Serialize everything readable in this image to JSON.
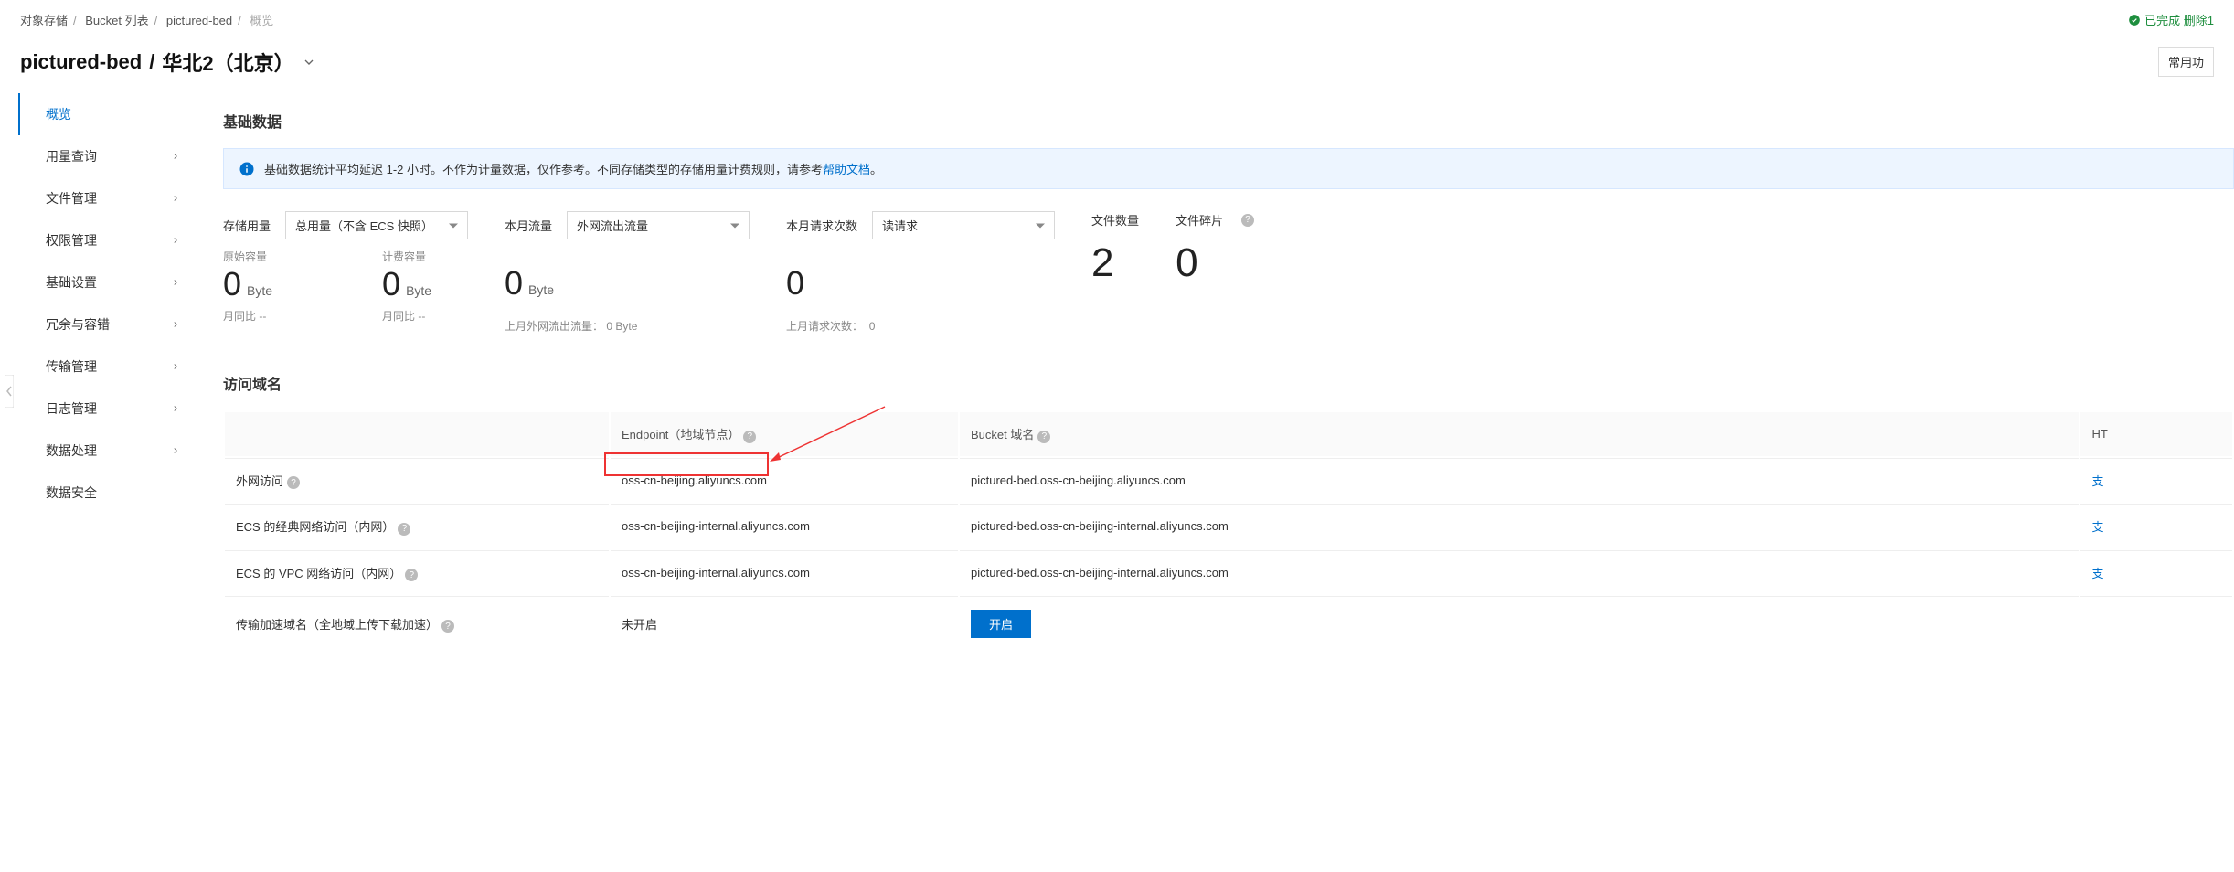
{
  "breadcrumb": {
    "root": "对象存储",
    "bucketList": "Bucket 列表",
    "bucket": "pictured-bed",
    "current": "概览"
  },
  "status": "已完成 删除1",
  "title": {
    "bucket": "pictured-bed",
    "region": "华北2（北京）"
  },
  "frequentBtn": "常用功",
  "sidebar": {
    "items": [
      {
        "label": "概览",
        "hasChev": false,
        "active": true
      },
      {
        "label": "用量查询",
        "hasChev": true
      },
      {
        "label": "文件管理",
        "hasChev": true
      },
      {
        "label": "权限管理",
        "hasChev": true
      },
      {
        "label": "基础设置",
        "hasChev": true
      },
      {
        "label": "冗余与容错",
        "hasChev": true
      },
      {
        "label": "传输管理",
        "hasChev": true
      },
      {
        "label": "日志管理",
        "hasChev": true
      },
      {
        "label": "数据处理",
        "hasChev": true
      },
      {
        "label": "数据安全",
        "hasChev": false
      }
    ]
  },
  "sections": {
    "basicData": "基础数据",
    "accessDomain": "访问域名"
  },
  "alert": {
    "text": "基础数据统计平均延迟 1-2 小时。不作为计量数据，仅作参考。不同存储类型的存储用量计费规则，请参考",
    "link": "帮助文档",
    "tail": "。"
  },
  "stats": {
    "storage": {
      "label": "存储用量",
      "selectValue": "总用量（不含 ECS 快照）",
      "raw": {
        "label": "原始容量",
        "value": "0",
        "unit": "Byte",
        "compare": "月同比  --"
      },
      "billed": {
        "label": "计费容量",
        "value": "0",
        "unit": "Byte",
        "compare": "月同比  --"
      }
    },
    "traffic": {
      "label": "本月流量",
      "selectValue": "外网流出流量",
      "value": "0",
      "unit": "Byte",
      "last": {
        "label": "上月外网流出流量：",
        "value": "0 Byte"
      }
    },
    "requests": {
      "label": "本月请求次数",
      "selectValue": "读请求",
      "value": "0",
      "last": {
        "label": "上月请求次数：",
        "value": "0"
      }
    },
    "files": {
      "label": "文件数量",
      "value": "2"
    },
    "fragments": {
      "label": "文件碎片",
      "value": "0"
    }
  },
  "domain": {
    "headers": {
      "type": "",
      "endpoint": "Endpoint（地域节点）",
      "bucket": "Bucket 域名",
      "right": "HT"
    },
    "rows": [
      {
        "type": "外网访问",
        "help": true,
        "endpoint": "oss-cn-beijing.aliyuncs.com",
        "bucket": "pictured-bed.oss-cn-beijing.aliyuncs.com",
        "right": "支"
      },
      {
        "type": "ECS 的经典网络访问（内网）",
        "help": true,
        "endpoint": "oss-cn-beijing-internal.aliyuncs.com",
        "bucket": "pictured-bed.oss-cn-beijing-internal.aliyuncs.com",
        "right": "支"
      },
      {
        "type": "ECS 的 VPC 网络访问（内网）",
        "help": true,
        "endpoint": "oss-cn-beijing-internal.aliyuncs.com",
        "bucket": "pictured-bed.oss-cn-beijing-internal.aliyuncs.com",
        "right": "支"
      },
      {
        "type": "传输加速域名（全地域上传下载加速）",
        "help": true,
        "endpoint": "未开启",
        "bucket_action": "开启",
        "right": ""
      }
    ]
  }
}
